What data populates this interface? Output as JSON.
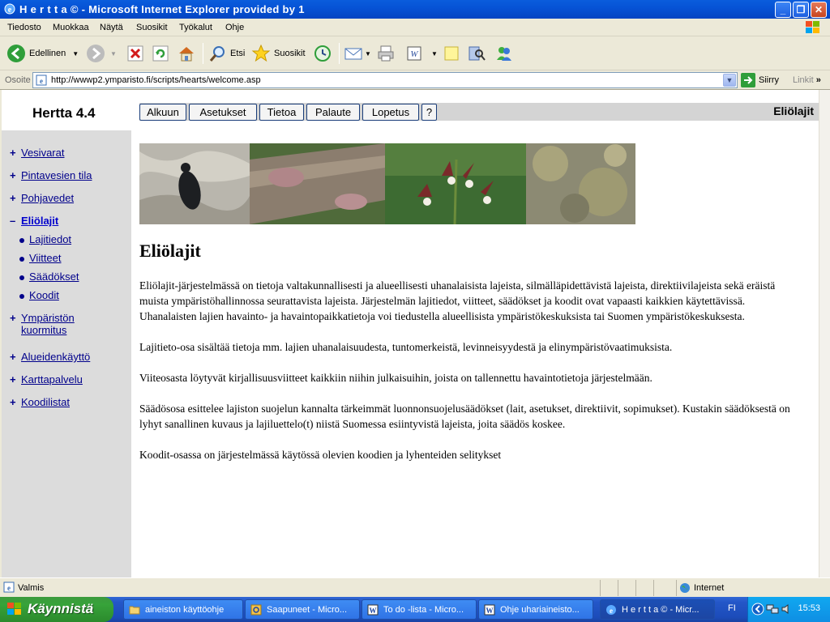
{
  "window": {
    "title": "H e r t t a © - Microsoft Internet Explorer provided by 1"
  },
  "menu": [
    "Tiedosto",
    "Muokkaa",
    "Näytä",
    "Suosikit",
    "Työkalut",
    "Ohje"
  ],
  "toolbar": {
    "back": "Edellinen",
    "search": "Etsi",
    "favorites": "Suosikit"
  },
  "address": {
    "label": "Osoite",
    "url": "http://wwwp2.ymparisto.fi/scripts/hearts/welcome.asp",
    "go": "Siirry",
    "links": "Linkit"
  },
  "sidebar": {
    "brand": "Hertta 4.4",
    "items": [
      {
        "marker": "+",
        "label": "Vesivarat"
      },
      {
        "marker": "+",
        "label": "Pintavesien tila"
      },
      {
        "marker": "+",
        "label": "Pohjavedet"
      },
      {
        "marker": "–",
        "label": "Eliölajit"
      },
      {
        "marker": "+",
        "label": "Ympäristön"
      },
      {
        "marker": "+",
        "label": "Alueidenkäyttö"
      },
      {
        "marker": "+",
        "label": "Karttapalvelu"
      },
      {
        "marker": "+",
        "label": "Koodilistat"
      }
    ],
    "item5_line2": "kuormitus",
    "subitems": [
      "Lajitiedot",
      "Viitteet",
      "Säädökset",
      "Koodit"
    ]
  },
  "topnav": {
    "buttons": [
      "Alkuun",
      "Asetukset",
      "Tietoa",
      "Palaute",
      "Lopetus",
      "?"
    ],
    "section": "Eliölajit"
  },
  "content": {
    "heading": "Eliölajit",
    "paragraphs": [
      "Eliölajit-järjestelmässä on tietoja valtakunnallisesti ja alueellisesti uhanalaisista lajeista, silmälläpidettävistä lajeista, direktiivilajeista sekä eräistä muista ympäristöhallinnossa seurattavista lajeista. Järjestelmän lajitiedot, viitteet, säädökset ja koodit ovat vapaasti kaikkien käytettävissä. Uhanalaisten lajien havainto- ja havaintopaikkatietoja voi tiedustella alueellisista ympäristökeskuksista tai Suomen ympäristökeskuksesta.",
      "Lajitieto-osa sisältää tietoja mm. lajien uhanalaisuudesta, tuntomerkeistä, levinneisyydestä ja elinympäristövaatimuksista.",
      "Viiteosasta löytyvät kirjallisuusviitteet kaikkiin niihin julkaisuihin, joista on tallennettu havaintotietoja järjestelmään.",
      "Säädösosa esittelee lajiston suojelun kannalta tärkeimmät luonnonsuojelusäädökset (lait, asetukset, direktiivit, sopimukset). Kustakin säädöksestä on lyhyt sanallinen kuvaus ja lajiluettelo(t) niistä Suomessa esiintyvistä lajeista, joita säädös koskee.",
      "Koodit-osassa on järjestelmässä käytössä olevien koodien ja lyhenteiden selitykset"
    ]
  },
  "status": {
    "text": "Valmis",
    "zone": "Internet"
  },
  "taskbar": {
    "start": "Käynnistä",
    "tasks": [
      "aineiston käyttöohje",
      "Saapuneet - Micro...",
      "To do -lista - Micro...",
      "Ohje uhariaineisto...",
      "H e r t t a © - Micr..."
    ],
    "lang": "FI",
    "clock": "15:53"
  },
  "colors": {
    "titlebar": "#0653d6",
    "link": "#00008b",
    "sidebar": "#dcdcdc",
    "taskbar": "#245edb",
    "start": "#37a33a"
  }
}
